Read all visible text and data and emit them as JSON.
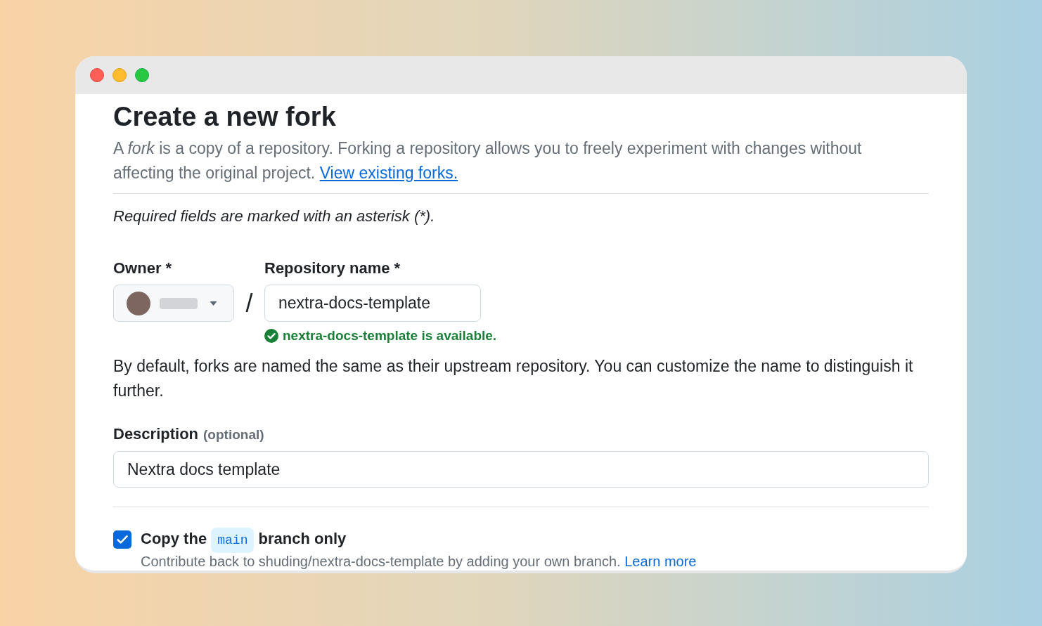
{
  "window": {
    "buttons": [
      {
        "kind": "close",
        "color": "#ff5f57"
      },
      {
        "kind": "minimize",
        "color": "#febc2e"
      },
      {
        "kind": "maximize",
        "color": "#28c840"
      }
    ]
  },
  "header": {
    "title": "Create a new fork",
    "intro": "A *fork* is a copy of a repository. Forking a repository allows you to freely experiment with changes without affecting the original project.",
    "intro_link": "View existing forks."
  },
  "required_note": "Required fields are marked with an asterisk (*).",
  "owner": {
    "label": "Owner *"
  },
  "separator": "/",
  "repository_name": {
    "label": "Repository name *",
    "value": "nextra-docs-template",
    "status": "nextra-docs-template is available."
  },
  "name_help": "By default, forks are named the same as their upstream repository. You can customize the name to distinguish it further.",
  "description": {
    "label": "Description",
    "hint": "(optional)",
    "value": "Nextra docs template"
  },
  "copy_branch": {
    "checked": true,
    "label_before": "Copy the",
    "branch": "main",
    "label_after": "branch only",
    "help": "Contribute back to shuding/nextra-docs-template by adding your own branch.",
    "link": "Learn more"
  }
}
